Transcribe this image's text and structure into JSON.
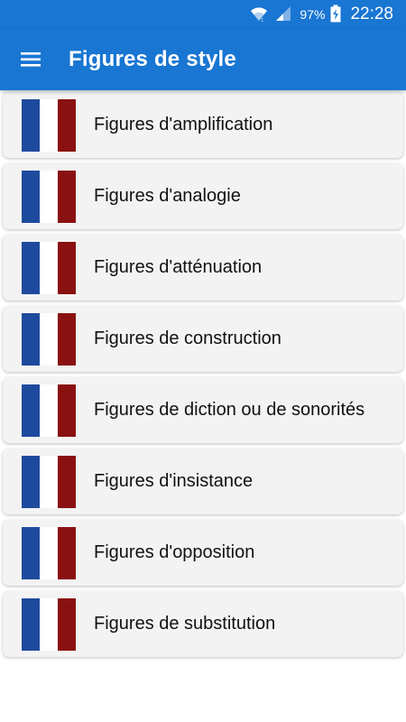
{
  "status_bar": {
    "battery_percent": "97%",
    "time": "22:28",
    "icons": [
      "wifi-icon",
      "signal-icon",
      "battery-charging-icon"
    ]
  },
  "app_bar": {
    "title": "Figures de style",
    "menu_icon": "hamburger-menu-icon"
  },
  "colors": {
    "primary": "#1976d2",
    "flag_blue": "#1e4a9e",
    "flag_white": "#ffffff",
    "flag_red": "#8a1111",
    "card_bg": "#f3f3f3"
  },
  "items": [
    {
      "label": "Figures d'amplification",
      "icon": "french-flag-icon"
    },
    {
      "label": "Figures d'analogie",
      "icon": "french-flag-icon"
    },
    {
      "label": "Figures d'atténuation",
      "icon": "french-flag-icon"
    },
    {
      "label": "Figures de construction",
      "icon": "french-flag-icon"
    },
    {
      "label": "Figures de diction ou de sonorités",
      "icon": "french-flag-icon"
    },
    {
      "label": "Figures d'insistance",
      "icon": "french-flag-icon"
    },
    {
      "label": "Figures d'opposition",
      "icon": "french-flag-icon"
    },
    {
      "label": "Figures de substitution",
      "icon": "french-flag-icon"
    }
  ]
}
